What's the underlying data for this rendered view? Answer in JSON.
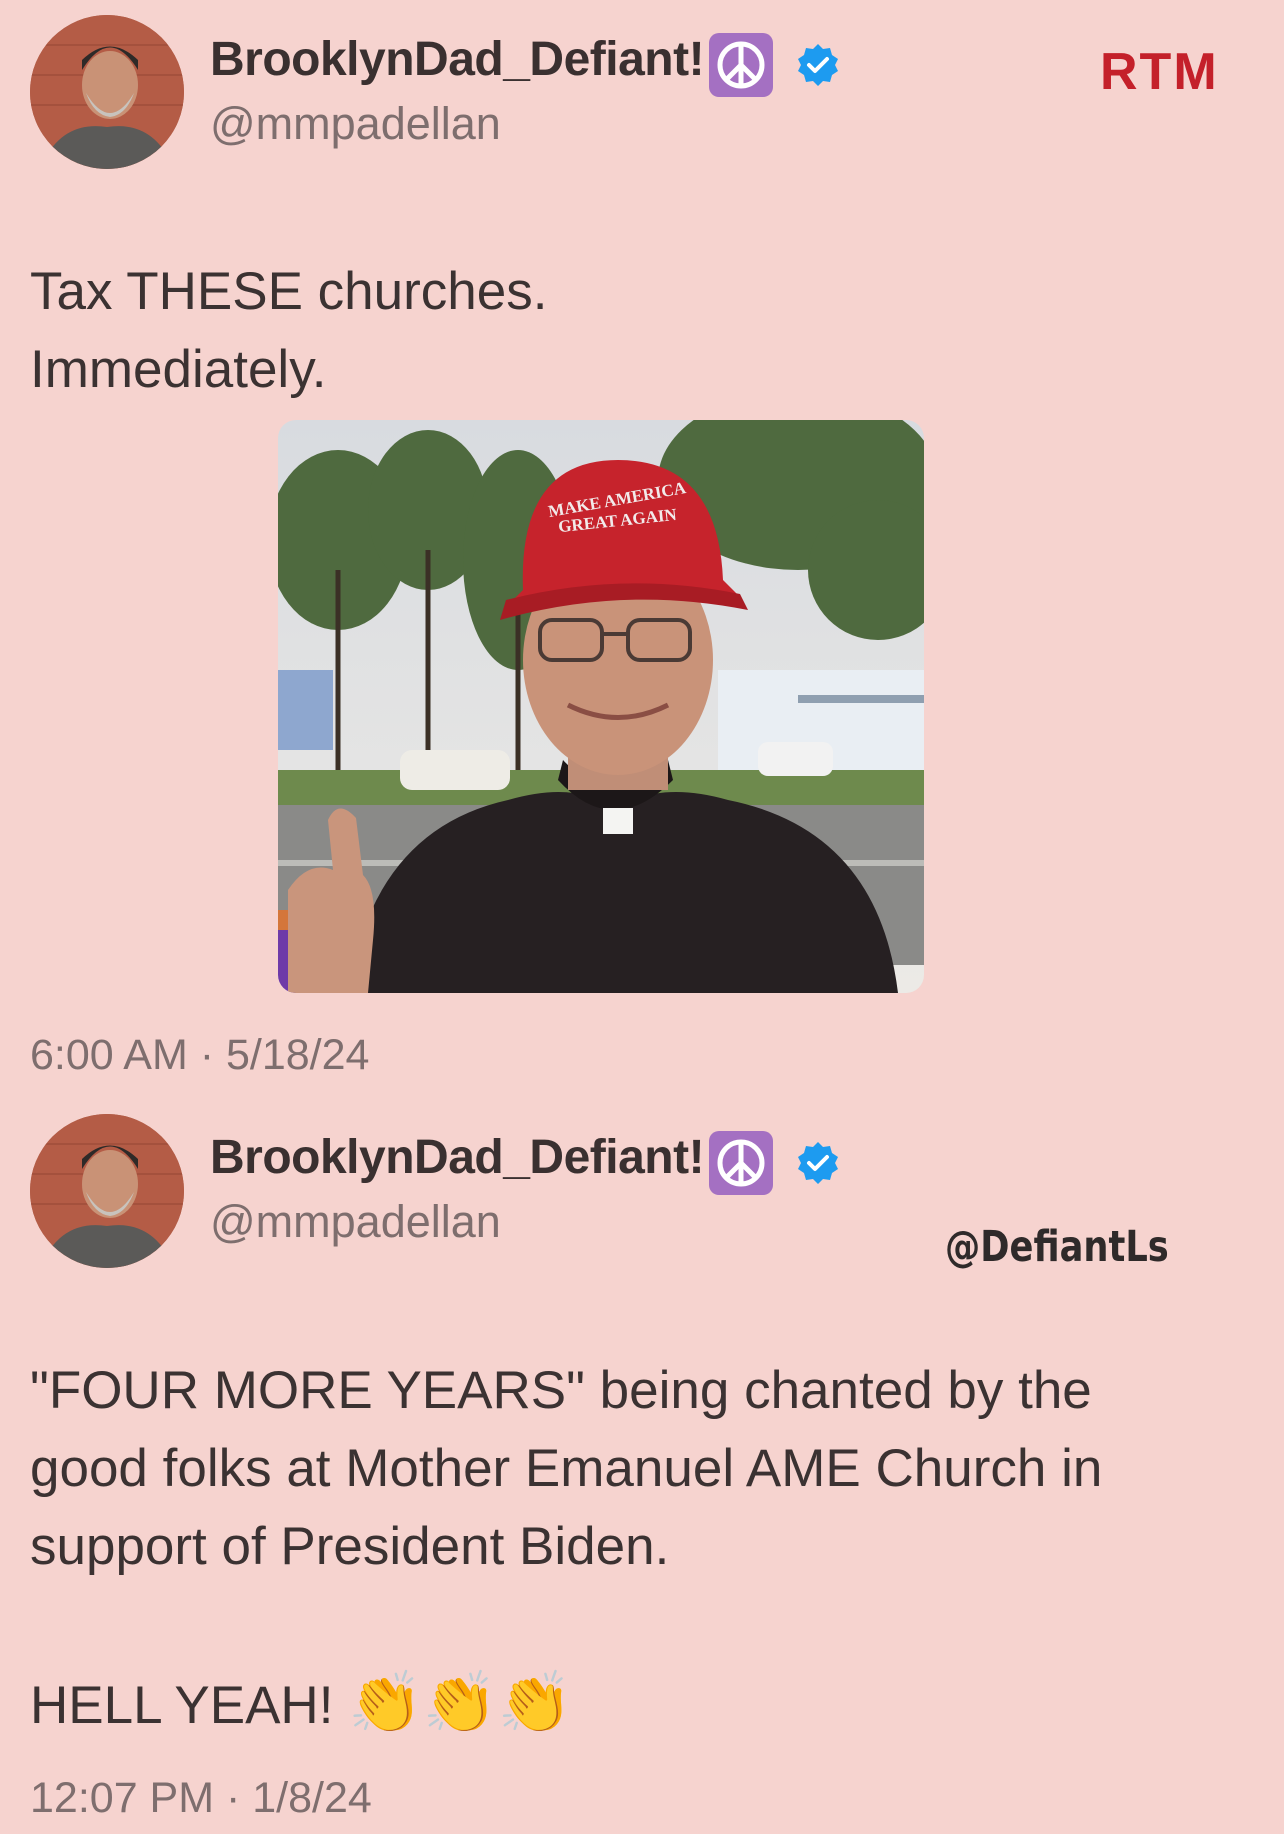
{
  "brand": {
    "logo": "RTM"
  },
  "watermark": "@DefiantLs",
  "tweets": [
    {
      "author": {
        "display_name": "BrooklynDad_Defiant!",
        "handle": "@mmpadellan",
        "badge_icon": "peace-symbol-icon",
        "verified_icon": "verified-badge-icon"
      },
      "text_lines": [
        "Tax THESE churches.",
        "Immediately."
      ],
      "image": {
        "hat_text_line1": "MAKE AMERICA",
        "hat_text_line2": "GREAT AGAIN"
      },
      "timestamp": "6:00 AM · 5/18/24"
    },
    {
      "author": {
        "display_name": "BrooklynDad_Defiant!",
        "handle": "@mmpadellan",
        "badge_icon": "peace-symbol-icon",
        "verified_icon": "verified-badge-icon"
      },
      "text_lines": [
        "\"FOUR MORE YEARS\" being chanted by the",
        "good folks at Mother Emanuel AME Church in",
        "support of President Biden.",
        "",
        "HELL YEAH!"
      ],
      "emoji": [
        "👏",
        "👏",
        "👏"
      ],
      "timestamp": "12:07 PM · 1/8/24"
    }
  ],
  "colors": {
    "background": "#f6d3cf",
    "brand_red": "#c4202a",
    "verified_blue": "#1d9bf0",
    "peace_purple": "#a470c2"
  }
}
